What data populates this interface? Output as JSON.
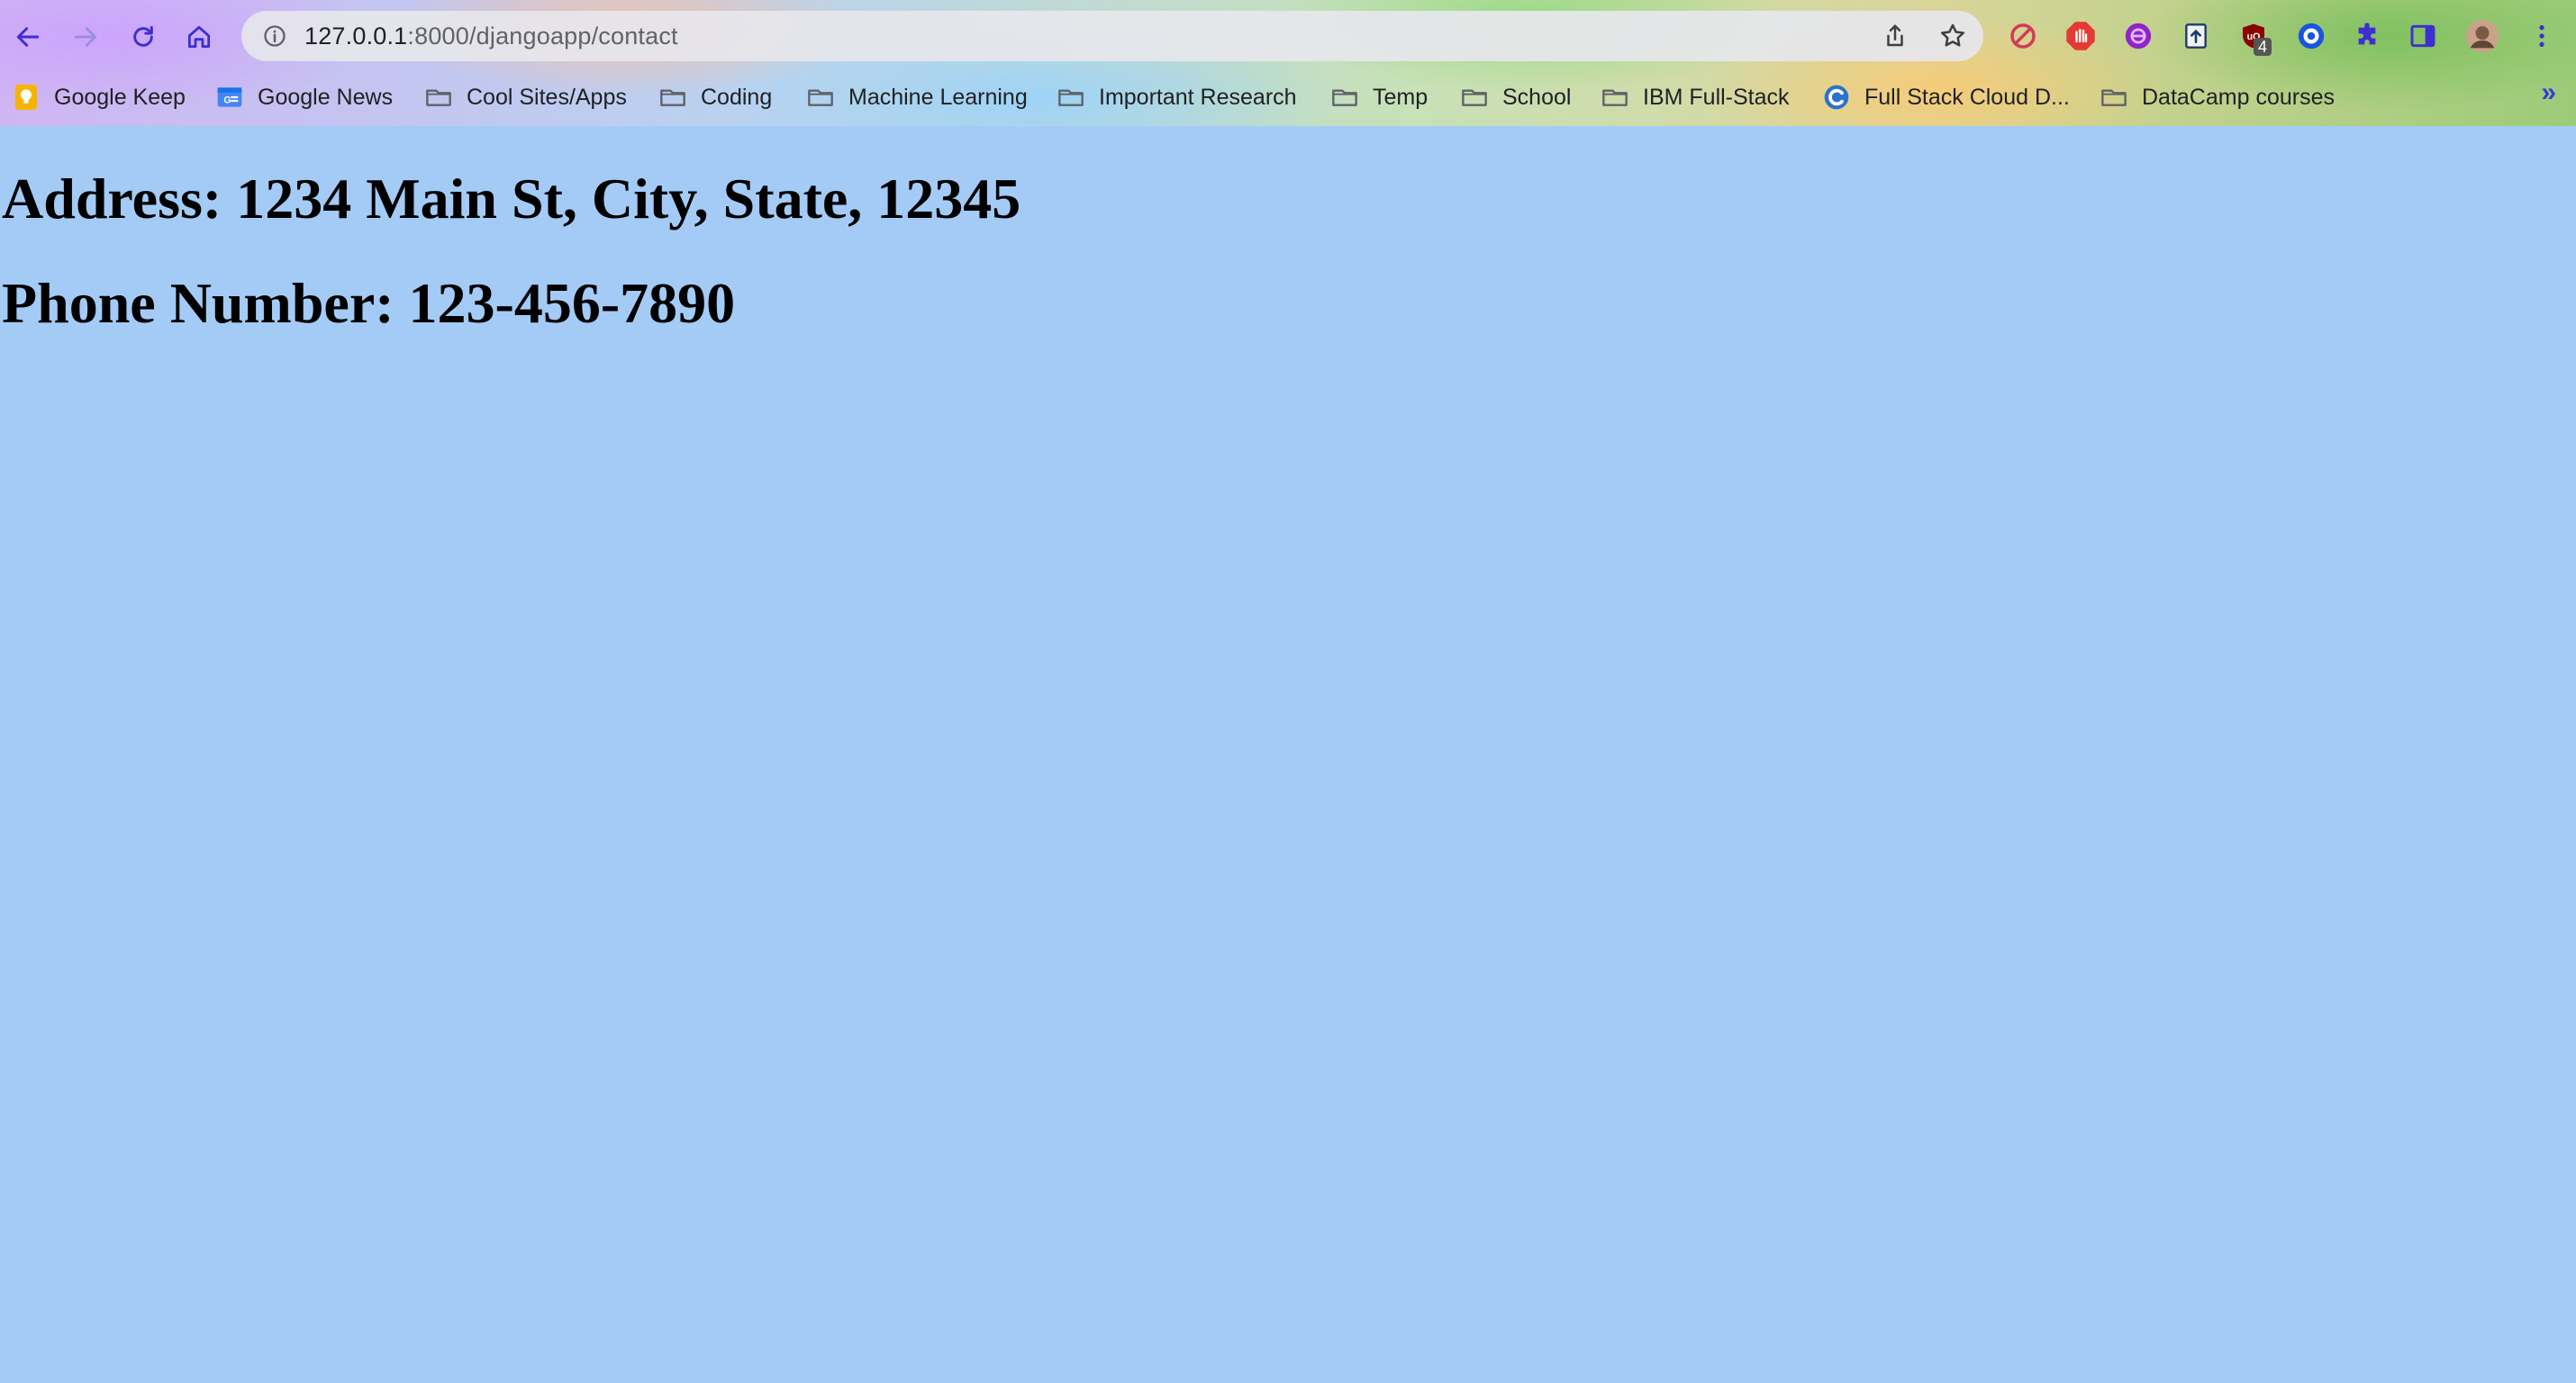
{
  "browser": {
    "url_host": "127.0.0.1",
    "url_rest": ":8000/djangoapp/contact",
    "extensions": [
      {
        "name": "block-icon",
        "color": "#d23a5a"
      },
      {
        "name": "stop-hand-icon",
        "color": "#e53935"
      },
      {
        "name": "globe-extension-icon",
        "color": "#8e24c9"
      },
      {
        "name": "upload-extension-icon",
        "color": "#1c3c6e"
      },
      {
        "name": "ublock-icon",
        "color": "#8b0000",
        "badge": "4"
      },
      {
        "name": "target-extension-icon",
        "color": "#1a55e0"
      },
      {
        "name": "puzzle-icon",
        "color": "#3d2fd0"
      },
      {
        "name": "side-panel-icon",
        "color": "#3d2fd0"
      },
      {
        "name": "profile-avatar",
        "color": "#b08a70"
      },
      {
        "name": "menu-icon",
        "color": "#3d2fd0"
      }
    ]
  },
  "bookmarks": [
    {
      "label": "Google Keep",
      "icon": "keep-icon"
    },
    {
      "label": "Google News",
      "icon": "news-icon"
    },
    {
      "label": "Cool Sites/Apps",
      "icon": "folder-icon"
    },
    {
      "label": "Coding",
      "icon": "folder-icon"
    },
    {
      "label": "Machine Learning",
      "icon": "folder-icon"
    },
    {
      "label": "Important Research",
      "icon": "folder-icon"
    },
    {
      "label": "Temp",
      "icon": "folder-icon"
    },
    {
      "label": "School",
      "icon": "folder-icon"
    },
    {
      "label": "IBM Full-Stack",
      "icon": "folder-icon"
    },
    {
      "label": "Full Stack Cloud D...",
      "icon": "coursera-icon"
    },
    {
      "label": "DataCamp courses",
      "icon": "folder-icon"
    }
  ],
  "bookmarks_overflow": "»",
  "page": {
    "background": "#a3cbf6",
    "address": "Address: 1234 Main St, City, State, 12345",
    "phone": "Phone Number: 123-456-7890"
  }
}
